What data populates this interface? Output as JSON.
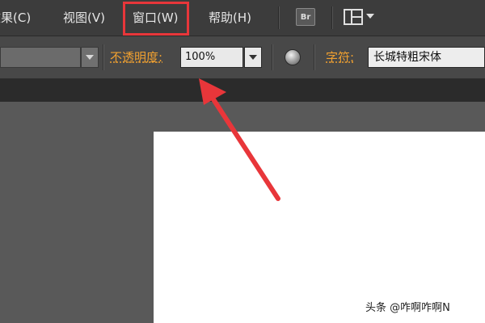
{
  "menubar": {
    "items": [
      {
        "label": "效果(C)"
      },
      {
        "label": "视图(V)"
      },
      {
        "label": "窗口(W)"
      },
      {
        "label": "帮助(H)"
      }
    ],
    "bridge_label": "Br",
    "highlight_color": "#e8363a"
  },
  "options": {
    "opacity_label": "不透明度:",
    "opacity_value": "100%",
    "char_label": "字符:",
    "font_value": "长城特粗宋体",
    "label_color": "#f0a030"
  },
  "icons": {
    "bridge": "bridge-icon",
    "arrange": "arrange-documents-icon",
    "globe": "recolor-globe-icon"
  },
  "annotation": {
    "arrow_color": "#e8363a"
  },
  "watermark": {
    "text": "头条 @咋啊咋啊N"
  }
}
